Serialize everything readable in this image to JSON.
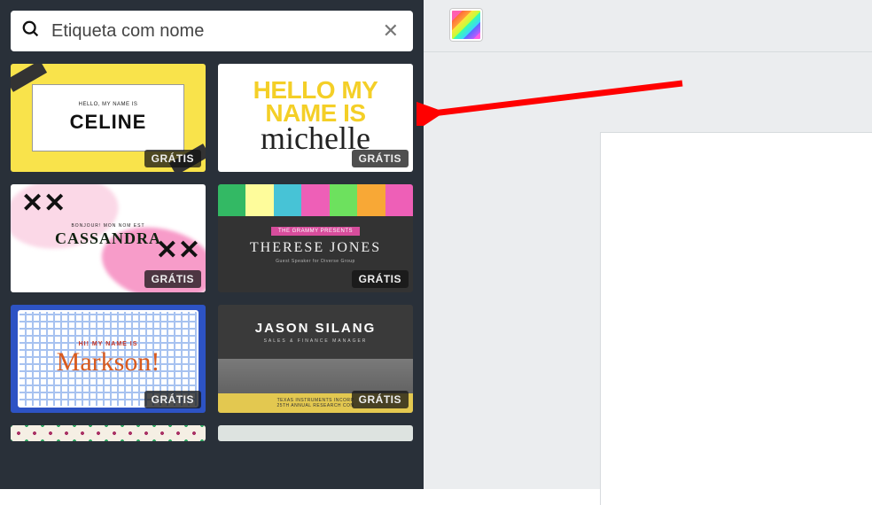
{
  "search": {
    "value": "Etiqueta com nome"
  },
  "badge_label": "GRÁTIS",
  "templates": [
    {
      "id": "celine",
      "subtitle": "HELLO, MY NAME IS",
      "title": "CELINE"
    },
    {
      "id": "michelle",
      "line1": "HELLO MY",
      "line2": "NAME IS",
      "script": "michelle"
    },
    {
      "id": "cassandra",
      "subtitle": "BONJOUR! MON NOM EST",
      "title": "CASSANDRA"
    },
    {
      "id": "therese",
      "tag": "THE GRAMMY PRESENTS",
      "title": "THERESE JONES",
      "sub": "Guest Speaker for Diverse Group"
    },
    {
      "id": "markson",
      "subtitle": "HI! MY NAME IS",
      "title": "Markson!"
    },
    {
      "id": "jason",
      "title": "JASON SILANG",
      "role": "SALES & FINANCE MANAGER",
      "line1": "TEXAS INSTRUMENTS INCORP",
      "line2": "25TH ANNUAL RESEARCH CON"
    }
  ],
  "collapse_glyph": "‹"
}
